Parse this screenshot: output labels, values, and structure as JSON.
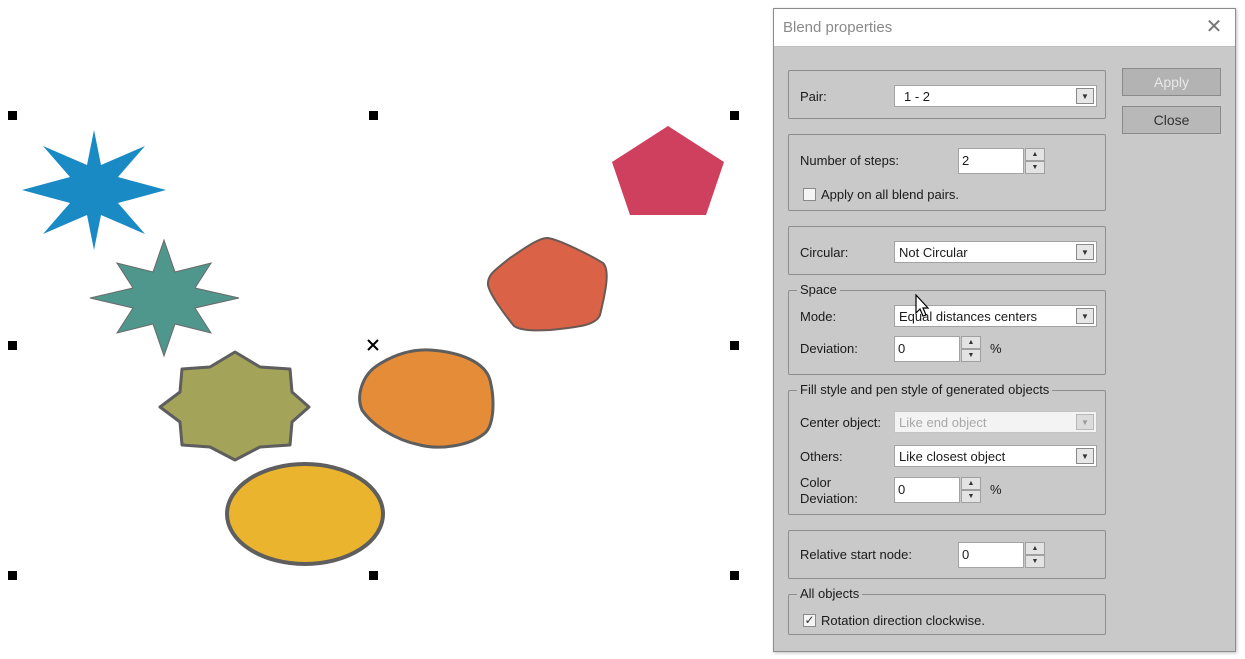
{
  "dialog": {
    "title": "Blend properties",
    "buttons": {
      "apply": "Apply",
      "close": "Close"
    },
    "pair": {
      "label": "Pair:",
      "value": "1 -  2"
    },
    "steps": {
      "label": "Number of steps:",
      "value": "2",
      "apply_all_label": "Apply on all blend pairs.",
      "apply_all_checked": false
    },
    "circular": {
      "label": "Circular:",
      "value": "Not Circular"
    },
    "space": {
      "legend": "Space",
      "mode_label": "Mode:",
      "mode_value": "Equal distances centers",
      "deviation_label": "Deviation:",
      "deviation_value": "0",
      "deviation_unit": "%"
    },
    "fill": {
      "legend": "Fill style and pen style of generated objects",
      "center_label": "Center object:",
      "center_value": "Like end object",
      "others_label": "Others:",
      "others_value": "Like closest object",
      "color_dev_label_1": "Color",
      "color_dev_label_2": "Deviation:",
      "color_dev_value": "0",
      "color_dev_unit": "%"
    },
    "start_node": {
      "label": "Relative start node:",
      "value": "0"
    },
    "all_objects": {
      "legend": "All objects",
      "rotation_label": "Rotation direction clockwise.",
      "rotation_checked": true
    }
  },
  "canvas": {
    "shapes": [
      {
        "name": "blue-star",
        "color": "#1a8ac4"
      },
      {
        "name": "teal-star",
        "color": "#4f968c"
      },
      {
        "name": "olive-star",
        "color": "#a3a35a"
      },
      {
        "name": "yellow-ellipse",
        "color": "#eab42e"
      },
      {
        "name": "orange-blob",
        "color": "#e58c38"
      },
      {
        "name": "red-orange-pentagon",
        "color": "#d96247"
      },
      {
        "name": "crimson-pentagon",
        "color": "#cf3f5e"
      }
    ],
    "outline_color": "#5e5e5e"
  }
}
